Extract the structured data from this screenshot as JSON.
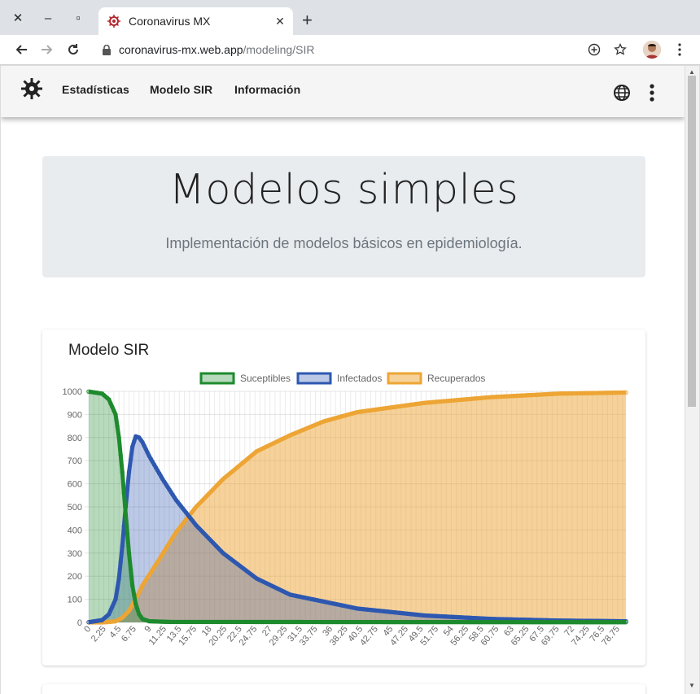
{
  "browser": {
    "tab_title": "Coronavirus MX",
    "url_host": "coronavirus-mx.web.app",
    "url_path": "/modeling/SIR"
  },
  "navbar": {
    "links": [
      "Estadísticas",
      "Modelo SIR",
      "Información"
    ]
  },
  "hero": {
    "title": "Modelos simples",
    "subtitle": "Implementación de modelos básicos en epidemiología."
  },
  "card": {
    "title": "Modelo SIR"
  },
  "colors": {
    "susceptible": "#1e8a2e",
    "infected": "#2e58b0",
    "recovered": "#eda535"
  },
  "chart_data": {
    "type": "line",
    "x_start": 0,
    "x_step": 0.25,
    "x_end": 80,
    "x_tick_labels": [
      "0",
      "2.25",
      "4.5",
      "6.75",
      "9",
      "11.25",
      "13.5",
      "15.75",
      "18",
      "20.25",
      "22.5",
      "24.75",
      "27",
      "29.25",
      "31.5",
      "33.75",
      "36",
      "38.25",
      "40.5",
      "42.75",
      "45",
      "47.25",
      "49.5",
      "51.75",
      "54",
      "56.25",
      "58.5",
      "60.75",
      "63",
      "65.25",
      "67.5",
      "69.75",
      "72",
      "74.25",
      "76.5",
      "78.75"
    ],
    "ylim": [
      0,
      1000
    ],
    "y_ticks": [
      0,
      100,
      200,
      300,
      400,
      500,
      600,
      700,
      800,
      900,
      1000
    ],
    "legend": [
      "Suceptibles",
      "Infectados",
      "Recuperados"
    ],
    "legend_position": "top-center",
    "grid": true,
    "series": [
      {
        "name": "Suceptibles",
        "x": [
          0,
          2,
          3,
          4,
          4.5,
          5,
          5.5,
          6,
          6.5,
          7,
          7.5,
          8,
          9,
          12,
          80
        ],
        "values": [
          999,
          990,
          965,
          900,
          800,
          650,
          470,
          300,
          160,
          80,
          35,
          15,
          5,
          2,
          1
        ]
      },
      {
        "name": "Infectados",
        "x": [
          0,
          2,
          3,
          4,
          4.5,
          5,
          5.5,
          6,
          6.5,
          7,
          7.5,
          8,
          9,
          11,
          13,
          16,
          20,
          25,
          30,
          40,
          50,
          60,
          70,
          80
        ],
        "values": [
          1,
          10,
          35,
          100,
          190,
          330,
          500,
          650,
          760,
          805,
          800,
          780,
          720,
          620,
          530,
          420,
          300,
          190,
          120,
          60,
          30,
          15,
          8,
          5
        ]
      },
      {
        "name": "Recuperados",
        "x": [
          0,
          2,
          3,
          4,
          5,
          6,
          7,
          8,
          10,
          13,
          16,
          20,
          25,
          30,
          35,
          40,
          50,
          60,
          70,
          80
        ],
        "values": [
          0,
          0,
          2,
          5,
          20,
          50,
          100,
          160,
          250,
          390,
          500,
          620,
          740,
          810,
          870,
          910,
          950,
          975,
          990,
          995
        ]
      }
    ]
  }
}
